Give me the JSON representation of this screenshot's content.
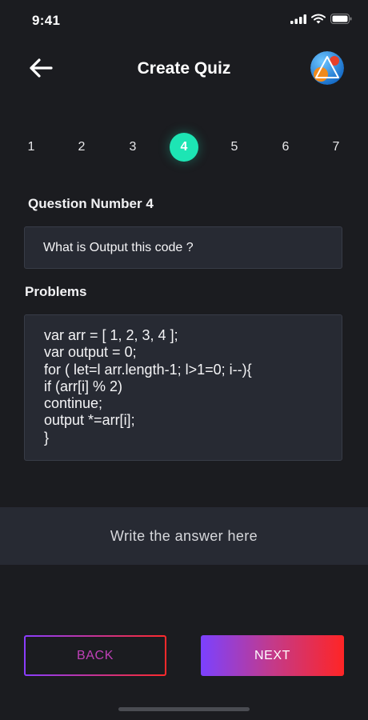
{
  "status_bar": {
    "time": "9:41"
  },
  "header": {
    "title": "Create Quiz"
  },
  "stepper": {
    "steps": [
      "1",
      "2",
      "3",
      "4",
      "5",
      "6",
      "7"
    ],
    "active": "4"
  },
  "question": {
    "label": "Question Number 4",
    "text": "What is Output this code ?"
  },
  "problems": {
    "label": "Problems",
    "code_lines": [
      "var arr = [ 1, 2, 3, 4 ];",
      "var output = 0;",
      "for ( let=l arr.length-1; l>1=0; i--){",
      "if (arr[i] % 2)",
      "continue;",
      "output *=arr[i];",
      "}"
    ]
  },
  "answer": {
    "placeholder": "Write the answer here"
  },
  "buttons": {
    "back": "BACK",
    "next": "NEXT"
  },
  "colors": {
    "background": "#1b1c20",
    "accent": "#1de5b4",
    "gradient_start": "#7b41ff",
    "gradient_end": "#ff2525"
  }
}
